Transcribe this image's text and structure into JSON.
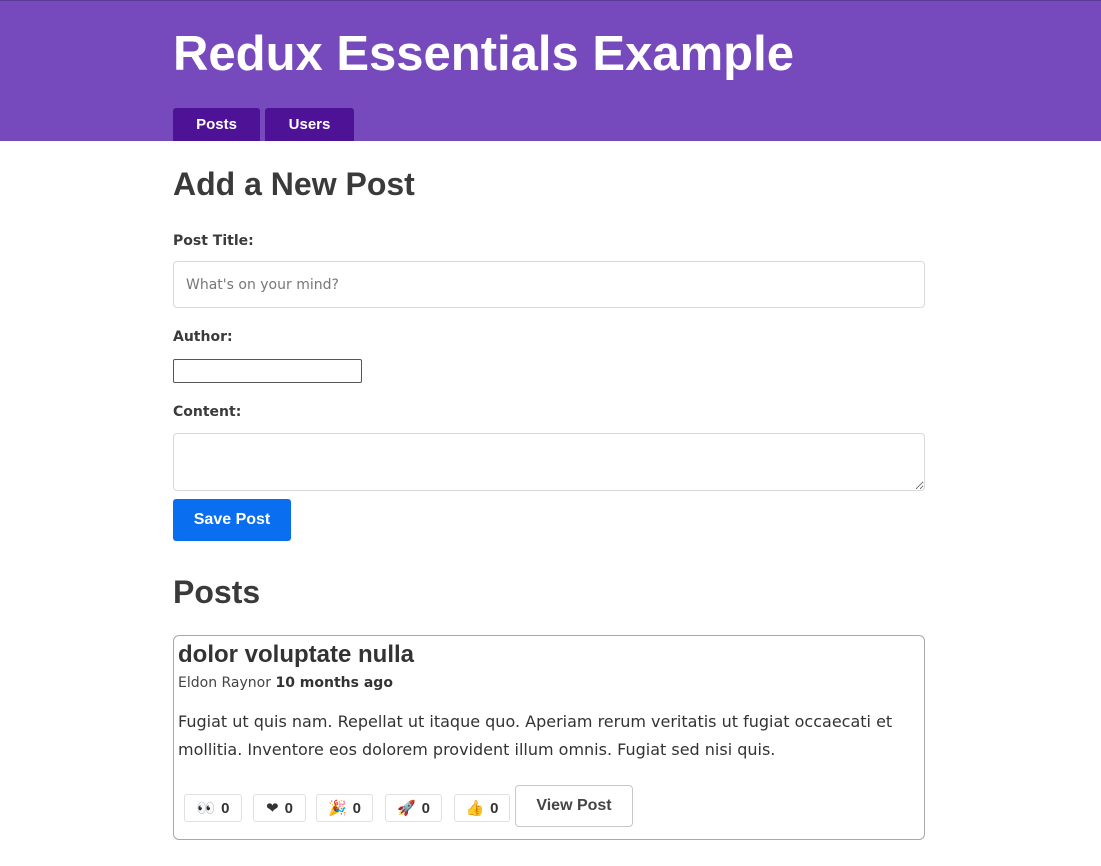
{
  "header": {
    "title": "Redux Essentials Example",
    "nav": [
      {
        "label": "Posts"
      },
      {
        "label": "Users"
      }
    ]
  },
  "add_post": {
    "heading": "Add a New Post",
    "title_label": "Post Title:",
    "title_placeholder": "What's on your mind?",
    "title_value": "",
    "author_label": "Author:",
    "author_value": "",
    "content_label": "Content:",
    "content_value": "",
    "save_label": "Save Post"
  },
  "posts": {
    "heading": "Posts",
    "items": [
      {
        "title": "dolor voluptate nulla",
        "author": "Eldon Raynor",
        "time": "10 months ago",
        "body": "Fugiat ut quis nam. Repellat ut itaque quo. Aperiam rerum veritatis ut fugiat occaecati et mollitia. Inventore eos dolorem provident illum omnis. Fugiat sed nisi quis.",
        "reactions": [
          {
            "icon": "eyes-icon",
            "emoji": "👀",
            "count": "0"
          },
          {
            "icon": "heart-icon",
            "emoji": "❤",
            "count": "0"
          },
          {
            "icon": "party-popper-icon",
            "emoji": "🎉",
            "count": "0"
          },
          {
            "icon": "rocket-icon",
            "emoji": "🚀",
            "count": "0"
          },
          {
            "icon": "thumbs-up-icon",
            "emoji": "👍",
            "count": "0"
          }
        ],
        "view_label": "View Post"
      }
    ]
  },
  "colors": {
    "header_bg": "#764abc",
    "nav_bg": "#4d1296",
    "save_button": "#0a6ef0"
  }
}
